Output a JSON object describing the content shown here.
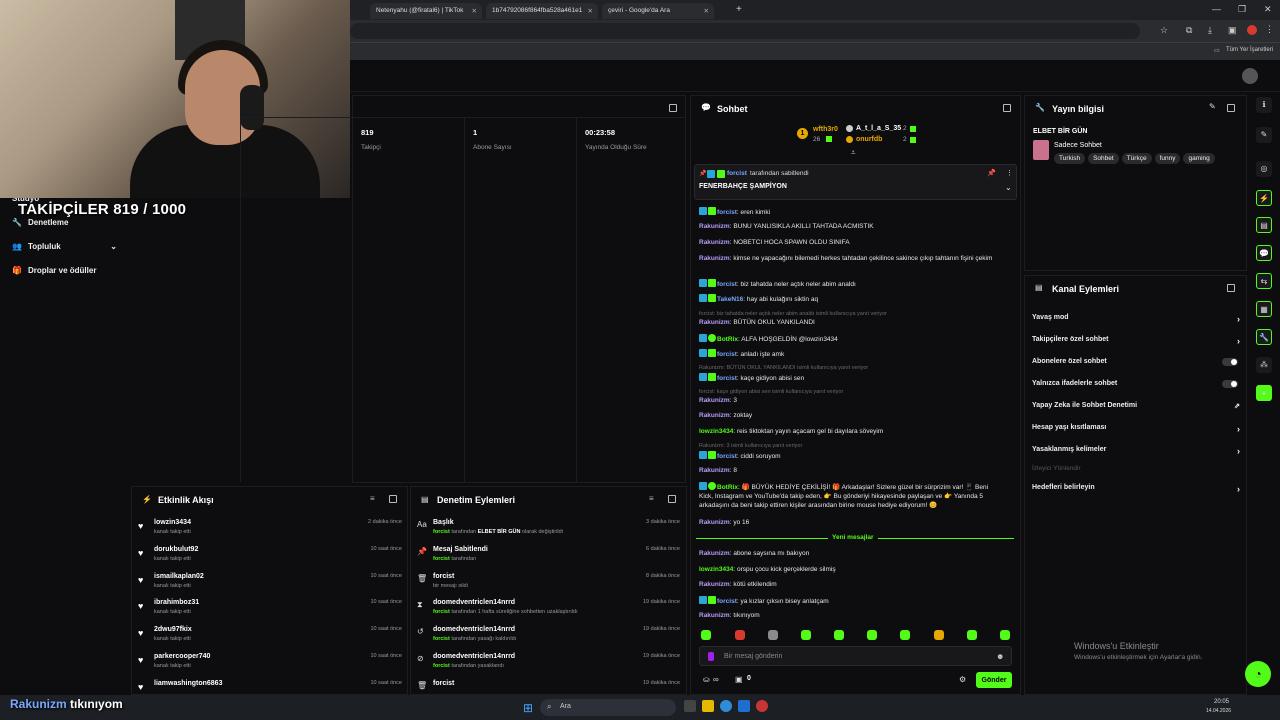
{
  "browser": {
    "tabs": [
      {
        "title": "Netenyahu (@firatal6) | TikTok"
      },
      {
        "title": "1b74792086f864fba528a461e1"
      },
      {
        "title": "çeviri - Google'da Ara"
      }
    ],
    "bookmarks_label": "Tüm Yer İşaretleri"
  },
  "webcam": {
    "overlay_text": "TAKİPÇİLER 819 / 1000"
  },
  "leftnav": {
    "items": [
      {
        "label": "Stüdyo"
      },
      {
        "label": "Denetleme"
      },
      {
        "label": "Topluluk"
      },
      {
        "label": "Droplar ve ödüller"
      }
    ]
  },
  "stats": [
    {
      "value": "819",
      "label": "Takipçi"
    },
    {
      "value": "1",
      "label": "Abone Sayısı"
    },
    {
      "value": "00:23:58",
      "label": "Yayında Olduğu Süre"
    }
  ],
  "activity": {
    "title": "Etkinlik Akışı",
    "rows": [
      {
        "name": "lowzin3434",
        "sub": "kanalı takip etti",
        "time": "2 dakika önce"
      },
      {
        "name": "dorukbulut92",
        "sub": "kanalı takip etti",
        "time": "10 saat önce"
      },
      {
        "name": "ismailkaplan02",
        "sub": "kanalı takip etti",
        "time": "10 saat önce"
      },
      {
        "name": "ibrahimboz31",
        "sub": "kanalı takip etti",
        "time": "10 saat önce"
      },
      {
        "name": "2dwu97fkix",
        "sub": "kanalı takip etti",
        "time": "10 saat önce"
      },
      {
        "name": "parkercooper740",
        "sub": "kanalı takip etti",
        "time": "10 saat önce"
      },
      {
        "name": "liamwashington6863",
        "sub": "",
        "time": "10 saat önce"
      }
    ]
  },
  "moderation": {
    "title": "Denetim Eylemleri",
    "rows": [
      {
        "name": "Başlık",
        "user": "forcist",
        "mid": "tarafından",
        "bold": "ELBET BİR GÜN",
        "end": "olarak değiştirildi",
        "time": "3 dakika önce",
        "icon": "text-icon"
      },
      {
        "name": "Mesaj Sabitlendi",
        "user": "forcist",
        "mid": "tarafından",
        "bold": "",
        "end": "",
        "time": "6 dakika önce",
        "icon": "pin-icon"
      },
      {
        "name": "forcist",
        "user": "",
        "mid": "bir mesajı sildi",
        "bold": "",
        "end": "",
        "time": "8 dakika önce",
        "icon": "trash-icon"
      },
      {
        "name": "doomedventriclen14nrrd",
        "user": "forcist",
        "mid": "tarafından 1 hafta süreliğine sohbetten uzaklaştırıldı",
        "bold": "",
        "end": "",
        "time": "19 dakika önce",
        "icon": "hourglass-icon"
      },
      {
        "name": "doomedventriclen14nrrd",
        "user": "forcist",
        "mid": "tarafından yasağı kaldırıldı",
        "bold": "",
        "end": "",
        "time": "19 dakika önce",
        "icon": "undo-icon"
      },
      {
        "name": "doomedventriclen14nrrd",
        "user": "forcist",
        "mid": "tarafından yasaklandı",
        "bold": "",
        "end": "",
        "time": "19 dakika önce",
        "icon": "ban-icon"
      },
      {
        "name": "forcist",
        "user": "",
        "mid": "",
        "bold": "",
        "end": "",
        "time": "19 dakika önce",
        "icon": "trash-icon"
      }
    ]
  },
  "chat": {
    "title": "Sohbet",
    "top_users": [
      {
        "rank": "1",
        "name": "wfth3r0",
        "count": "26"
      },
      {
        "name": "A_t_l_a_S_35",
        "count": "2"
      },
      {
        "name": "onurfdb",
        "count": "2"
      }
    ],
    "pinned": {
      "by": "forcist",
      "by_suffix": "tarafından sabitlendi",
      "text": "FENERBAHÇE ŞAMPİYON"
    },
    "messages": [
      {
        "user": "forcist",
        "color": "blue",
        "badges": true,
        "text": "eren kimki",
        "reply": ""
      },
      {
        "user": "Rakunizm",
        "color": "purple",
        "text": "BUNU YANLISIKLA AKILLI TAHTADA ACMISTIK",
        "reply": ""
      },
      {
        "user": "Rakunizm",
        "color": "purple",
        "text": "NOBETCI HOCA SPAWN OLDU SINIFA",
        "reply": ""
      },
      {
        "user": "Rakunizm",
        "color": "purple",
        "text": "kimse ne yapacağını bilemedi herkes tahtadan çekilince sakince çıkıp tahtanın fişini çekim",
        "reply": ""
      },
      {
        "user": "forcist",
        "color": "blue",
        "badges": true,
        "text": "biz tahatda neler açtık neler abim analdı",
        "reply": ""
      },
      {
        "user": "TakeN16",
        "color": "blue",
        "badges": true,
        "text": "hay abi kulağını siktin aq",
        "reply": ""
      },
      {
        "user": "Rakunizm",
        "color": "purple",
        "text": "BÜTÜN OKUL YANKILANDI",
        "reply": "forcist: biz tahatda neler açtık neler abim analdı isimli kullanıcıya yanıt veriyor"
      },
      {
        "user": "BotRix",
        "color": "green",
        "badges": true,
        "text": "ALFA HOŞGELDİN @lowzin3434",
        "reply": ""
      },
      {
        "user": "forcist",
        "color": "blue",
        "badges": true,
        "text": "anladı işte amk",
        "reply": ""
      },
      {
        "user": "forcist",
        "color": "blue",
        "badges": true,
        "text": "kaçe gidiyon abisi sen",
        "reply": "Rakunizm: BÜTÜN OKUL YANKILANDI isimli kullanıcıya yanıt veriyor"
      },
      {
        "user": "Rakunizm",
        "color": "purple",
        "text": "3",
        "reply": "forcist: kaçe gidiyon abisi sen isimli kullanıcıya yanıt veriyor"
      },
      {
        "user": "Rakunizm",
        "color": "purple",
        "text": "zoktay",
        "reply": ""
      },
      {
        "user": "lowzin3434",
        "color": "green",
        "text": "reis tiktoktan yayın açacam gel bi dayılara söveyim",
        "reply": ""
      },
      {
        "user": "forcist",
        "color": "blue",
        "badges": true,
        "text": "ciddi soruyom",
        "reply": "Rakunizm: 3 isimli kullanıcıya yanıt veriyor"
      },
      {
        "user": "Rakunizm",
        "color": "purple",
        "text": "8",
        "reply": ""
      },
      {
        "user": "BotRix",
        "color": "green",
        "badges": true,
        "text": "🎁 BÜYÜK HEDİYE ÇEKİLİŞİ! 🎁 Arkadaşlar! Sizlere güzel bir sürprizim var! 📱 Beni Kick, Instagram ve YouTube'da takip eden, 👉 Bu gönderiyi hikayesinde paylaşan ve 👉 Yanında 5 arkadaşını da beni takip ettiren kişiler arasından birine mouse hediye ediyorum! 😊",
        "reply": ""
      },
      {
        "user": "Rakunizm",
        "color": "purple",
        "text": "yo 16",
        "reply": ""
      }
    ],
    "new_messages_label": "Yeni mesajlar",
    "new_messages": [
      {
        "user": "Rakunizm",
        "color": "purple",
        "text": "abone saysına mı bakıyon"
      },
      {
        "user": "lowzin3434",
        "color": "green",
        "text": "orspu çocu kick gerçeklerde silmiş"
      },
      {
        "user": "Rakunizm",
        "color": "purple",
        "text": "kötü etkilendim"
      },
      {
        "user": "forcist",
        "color": "blue",
        "badges": true,
        "text": "ya kızlar çıksın bisey anlatçam"
      },
      {
        "user": "Rakunizm",
        "color": "purple",
        "text": "tıkınıyom"
      }
    ],
    "input_placeholder": "Bir mesaj gönderin",
    "send_label": "Gönder",
    "counter": "0",
    "points": "∞"
  },
  "stream_info": {
    "title": "Yayın bilgisi",
    "stream_title": "ELBET BİR GÜN",
    "category": "Sadece Sohbet",
    "tags": [
      "Turkish",
      "Sohbet",
      "Türkçe",
      "funny",
      "gaming"
    ]
  },
  "channel_actions": {
    "title": "Kanal Eylemleri",
    "items": [
      {
        "label": "Yavaş mod",
        "control": "chevron"
      },
      {
        "label": "Takipçilere özel sohbet",
        "control": "chevron"
      },
      {
        "label": "Abonelere özel sohbet",
        "control": "toggle"
      },
      {
        "label": "Yalnızca ifadelerle sohbet",
        "control": "toggle"
      },
      {
        "label": "Yapay Zeka ile Sohbet Denetimi",
        "control": "external"
      },
      {
        "label": "Hesap yaşı kısıtlaması",
        "control": "chevron"
      },
      {
        "label": "Yasaklanmış kelimeler",
        "control": "chevron"
      },
      {
        "label": "İzleyici Yönlendir",
        "control": "none",
        "disabled": true
      },
      {
        "label": "Hedefleri belirleyin",
        "control": "chevron"
      }
    ]
  },
  "windows": {
    "activate_title": "Windows'u Etkinleştir",
    "activate_sub": "Windows'u etkinleştirmek için Ayarlar'a gidin."
  },
  "taskbar": {
    "search_label": "Ara",
    "time": "20:05",
    "date": "14.04.2026"
  },
  "subtitle": {
    "highlight": "Rakunizm",
    "text": "tıkınıyom"
  },
  "colors": {
    "accent": "#53fc18",
    "bg": "#0d0d0f",
    "panel_border": "#1d1d20"
  }
}
